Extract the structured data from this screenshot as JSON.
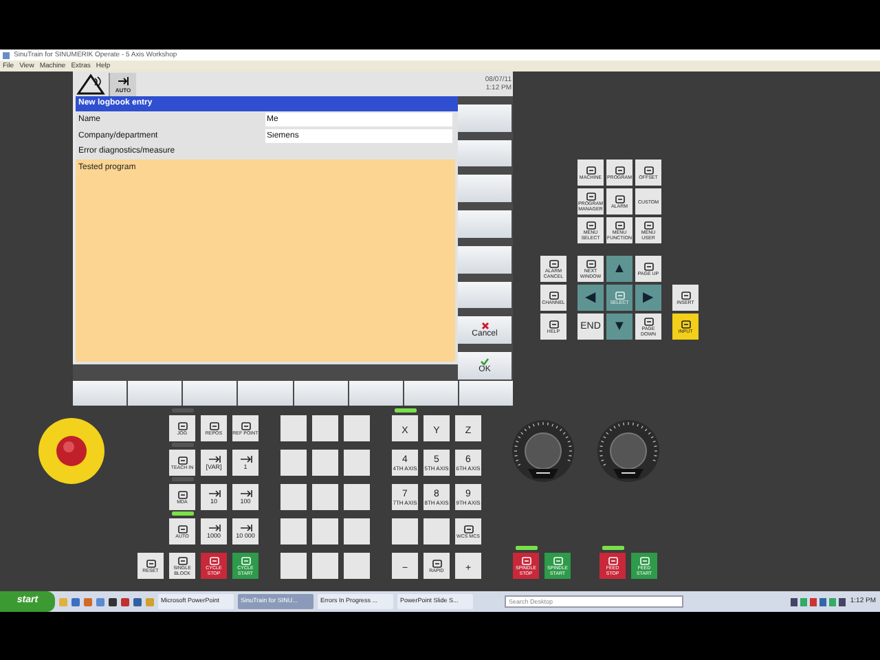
{
  "window": {
    "title": "SinuTrain for SINUMERIK Operate - 5 Axis Workshop"
  },
  "menu": [
    "File",
    "View",
    "Machine",
    "Extras",
    "Help"
  ],
  "hmi": {
    "mode": "AUTO",
    "date": "08/07/11",
    "time": "1:12 PM",
    "dialog": {
      "title": "New logbook entry",
      "fields": [
        {
          "label": "Name",
          "value": "Me"
        },
        {
          "label": "Company/department",
          "value": "Siemens"
        }
      ],
      "section": "Error diagnostics/measure",
      "text": "Tested program"
    },
    "softkeys": [
      {
        "label": "Cancel",
        "kind": "cancel"
      },
      {
        "label": "OK",
        "kind": "ok"
      }
    ]
  },
  "nav_top": [
    {
      "label": "MACHINE",
      "kind": "gray",
      "icon": true
    },
    {
      "label": "PROGRAM",
      "kind": "gray",
      "icon": true
    },
    {
      "label": "OFFSET",
      "kind": "gray",
      "icon": true
    },
    {
      "label": "PROGRAM MANAGER",
      "kind": "gray",
      "icon": true
    },
    {
      "label": "ALARM",
      "kind": "gray",
      "icon": true
    },
    {
      "label": "CUSTOM",
      "kind": "gray",
      "icon": false
    },
    {
      "label": "MENU SELECT",
      "kind": "gray",
      "icon": true
    },
    {
      "label": "MENU FUNCTION",
      "kind": "gray",
      "icon": true
    },
    {
      "label": "MENU USER",
      "kind": "gray",
      "icon": true
    }
  ],
  "nav_bottom": [
    {
      "label": "ALARM CANCEL",
      "kind": "gray",
      "icon": true
    },
    {
      "label": "NEXT WINDOW",
      "kind": "gray",
      "icon": true
    },
    {
      "label": "▲",
      "kind": "arrow",
      "icon": false
    },
    {
      "label": "PAGE UP",
      "kind": "gray",
      "icon": true
    },
    {
      "label": "CHANNEL",
      "kind": "gray",
      "icon": true
    },
    {
      "label": "◀",
      "kind": "arrow",
      "icon": false
    },
    {
      "label": "SELECT",
      "kind": "teal",
      "icon": true
    },
    {
      "label": "▶",
      "kind": "arrow",
      "icon": false
    },
    {
      "label": "INSERT",
      "kind": "gray",
      "icon": true
    },
    {
      "label": "HELP",
      "kind": "gray",
      "icon": true
    },
    {
      "label": "END",
      "kind": "big",
      "icon": false
    },
    {
      "label": "▼",
      "kind": "arrow",
      "icon": false
    },
    {
      "label": "PAGE DOWN",
      "kind": "gray",
      "icon": true
    },
    {
      "label": "INPUT",
      "kind": "yellow",
      "icon": true
    }
  ],
  "machine": {
    "reset": {
      "label": "RESET",
      "kind": "gray",
      "icon": true
    },
    "keys": [
      {
        "label": "JOG",
        "kind": "gray",
        "icon": true,
        "led": false
      },
      {
        "label": "REPOS",
        "kind": "gray",
        "icon": true
      },
      {
        "label": "REF POINT",
        "kind": "gray",
        "icon": true
      },
      {
        "label": "TEACH IN",
        "kind": "gray",
        "icon": true,
        "led": false
      },
      {
        "label": "[VAR]",
        "kind": "inc",
        "icon": true
      },
      {
        "label": "1",
        "kind": "inc",
        "icon": true
      },
      {
        "label": "MDA",
        "kind": "gray",
        "icon": true,
        "led": false
      },
      {
        "label": "10",
        "kind": "inc",
        "icon": true
      },
      {
        "label": "100",
        "kind": "inc",
        "icon": true
      },
      {
        "label": "AUTO",
        "kind": "gray",
        "icon": true,
        "led": true
      },
      {
        "label": "1000",
        "kind": "inc",
        "icon": true
      },
      {
        "label": "10 000",
        "kind": "inc",
        "icon": true
      },
      {
        "label": "SINGLE BLOCK",
        "kind": "gray",
        "icon": true
      },
      {
        "label": "CYCLE STOP",
        "kind": "red",
        "icon": true
      },
      {
        "label": "CYCLE START",
        "kind": "green",
        "icon": true
      }
    ]
  },
  "axes": [
    {
      "label": "X",
      "kind": "axis",
      "led": true
    },
    {
      "label": "Y",
      "kind": "axis"
    },
    {
      "label": "Z",
      "kind": "axis"
    },
    {
      "label": "4",
      "sublabel": "4TH AXIS",
      "kind": "axis"
    },
    {
      "label": "5",
      "sublabel": "5TH AXIS",
      "kind": "axis"
    },
    {
      "label": "6",
      "sublabel": "6TH AXIS",
      "kind": "axis"
    },
    {
      "label": "7",
      "sublabel": "7TH AXIS",
      "kind": "axis"
    },
    {
      "label": "8",
      "sublabel": "8TH AXIS",
      "kind": "axis"
    },
    {
      "label": "9",
      "sublabel": "9TH AXIS",
      "kind": "axis"
    },
    {
      "kind": "blank"
    },
    {
      "kind": "blank"
    },
    {
      "label": "WCS MCS",
      "kind": "gray",
      "icon": true
    },
    {
      "label": "−",
      "kind": "axis"
    },
    {
      "label": "RAPID",
      "kind": "gray",
      "icon": true
    },
    {
      "label": "+",
      "kind": "axis"
    }
  ],
  "spindle": [
    {
      "label": "SPINDLE STOP",
      "kind": "red",
      "icon": true,
      "led": true
    },
    {
      "label": "SPINDLE START",
      "kind": "green",
      "icon": true
    },
    {
      "label": "FEED STOP",
      "kind": "red",
      "icon": true,
      "led": true
    },
    {
      "label": "FEED START",
      "kind": "green",
      "icon": true
    }
  ],
  "taskbar": {
    "start": "start",
    "tasks": [
      {
        "label": "Microsoft PowerPoint",
        "selected": false
      },
      {
        "label": "SinuTrain for SINU...",
        "selected": true
      },
      {
        "label": "Errors In Progress ...",
        "selected": false
      },
      {
        "label": "PowerPoint Slide S...",
        "selected": false
      }
    ],
    "search": {
      "placeholder": "Search Desktop"
    },
    "clock": "1:12 PM"
  }
}
